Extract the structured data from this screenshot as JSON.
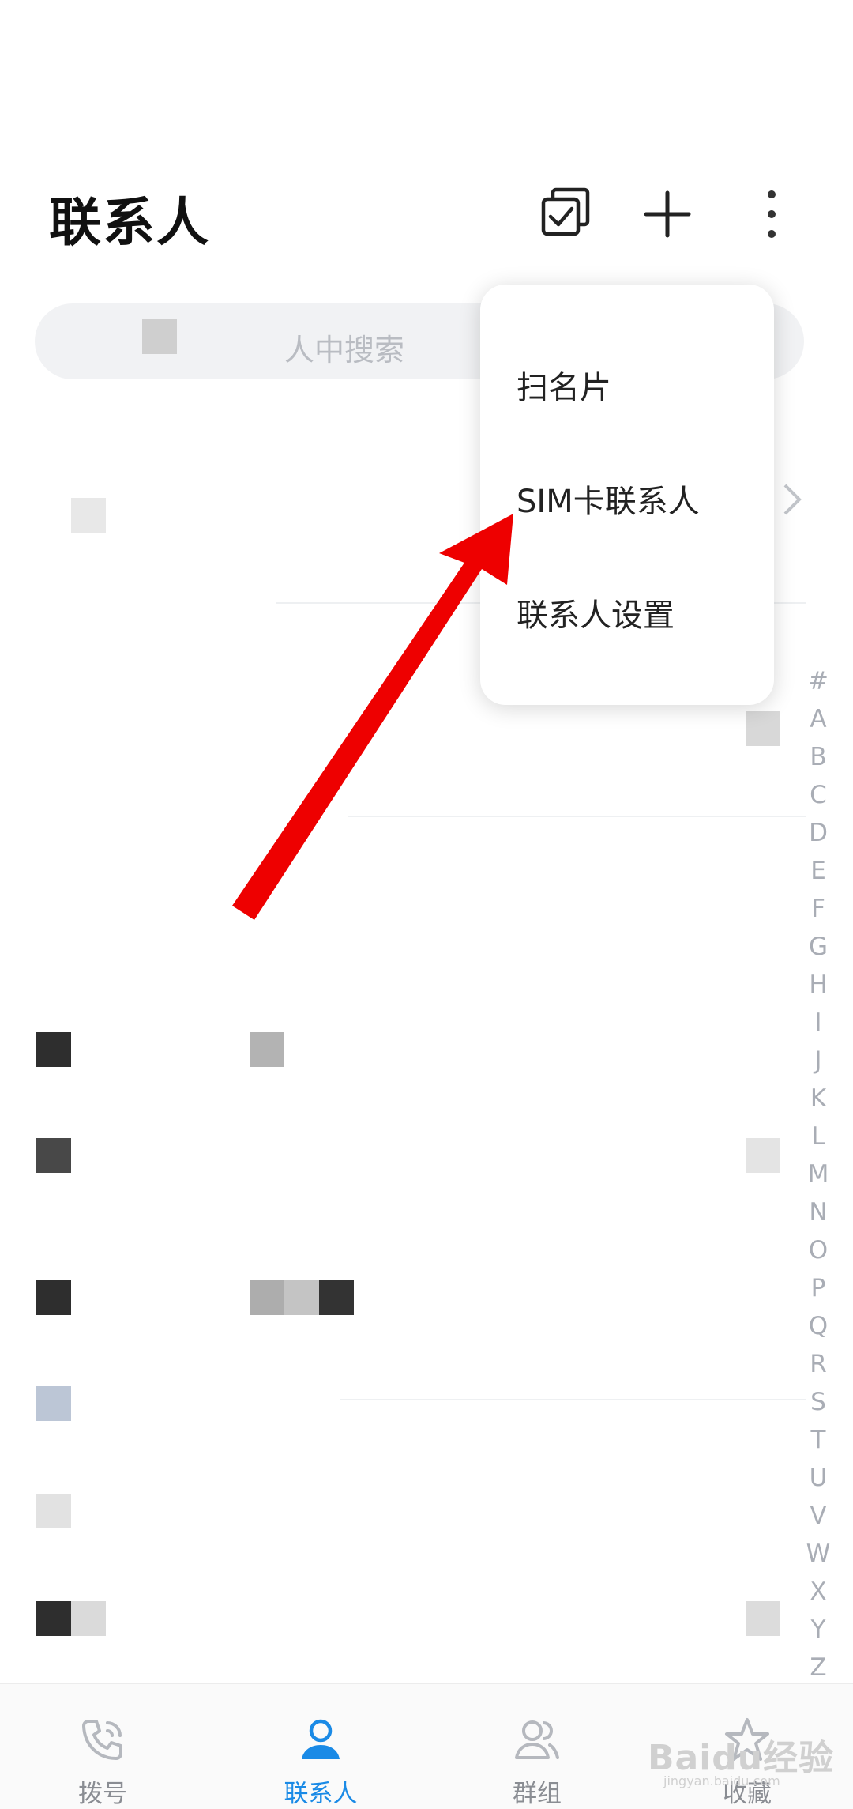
{
  "header": {
    "title": "联系人"
  },
  "search": {
    "visible_text": "人中搜索"
  },
  "popup_menu": {
    "items": [
      "扫名片",
      "SIM卡联系人",
      "联系人设置"
    ]
  },
  "alphabet_index": [
    "#",
    "A",
    "B",
    "C",
    "D",
    "E",
    "F",
    "G",
    "H",
    "I",
    "J",
    "K",
    "L",
    "M",
    "N",
    "O",
    "P",
    "Q",
    "R",
    "S",
    "T",
    "U",
    "V",
    "W",
    "X",
    "Y",
    "Z"
  ],
  "bottom_nav": {
    "items": [
      {
        "label": "拨号",
        "icon": "phone-icon",
        "active": false
      },
      {
        "label": "联系人",
        "icon": "person-icon",
        "active": true
      },
      {
        "label": "群组",
        "icon": "group-icon",
        "active": false
      },
      {
        "label": "收藏",
        "icon": "star-icon",
        "active": false
      }
    ]
  },
  "colors": {
    "accent": "#1a8ae6",
    "annotation_arrow": "#ee0000",
    "inactive": "#b5b8be"
  },
  "watermark": {
    "text": "Baidu经验",
    "sub": "jingyan.baidu.com"
  }
}
